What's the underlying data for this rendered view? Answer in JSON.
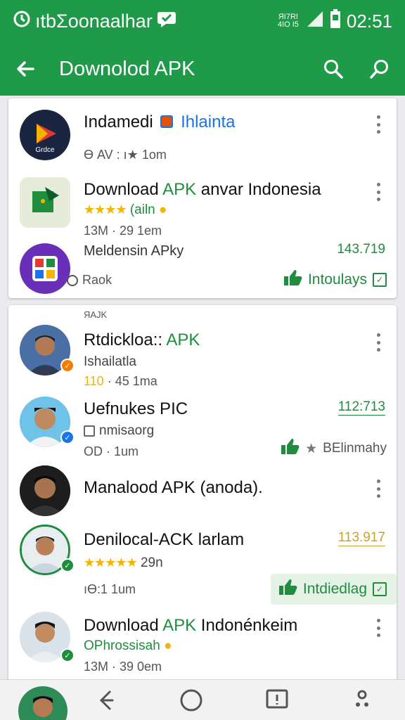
{
  "status_bar": {
    "carrier": "ıtbΣoonaalhar",
    "signal_text": "ЯI7RI\n4IO I5",
    "time": "02:51"
  },
  "app_bar": {
    "title": "Downolod APK",
    "back_icon": "arrow-left-icon",
    "search_icon": "search-icon",
    "second_search_icon": "search-icon"
  },
  "card1": {
    "items": [
      {
        "title_a": "Indamedi",
        "title_b": "Ihlainta",
        "meta": "ϴ AV : ı★ 1om"
      },
      {
        "title_a": "Download ",
        "title_b": "APK",
        "title_c": " anvar Indonesia",
        "rating_text": "(ailn",
        "meta": "13M · 29 1em"
      },
      {
        "title": "Meldensin APky",
        "price": "143.719",
        "meta": "Raok",
        "action": "Intoulays"
      }
    ]
  },
  "card2": {
    "section_label": "ЯAJK",
    "items": [
      {
        "title_a": "Rtdickloa:: ",
        "title_b": "APK",
        "subtitle": "Ishailatla",
        "meta_highlight": "110",
        "meta": " · 45 1ma"
      },
      {
        "title": "Uefnukes PIC",
        "price": "112:713",
        "subtitle": "nmisaorg",
        "meta": "OD · 1um",
        "action": "BElinmahy"
      },
      {
        "title": "Manalood APK (anoda)."
      },
      {
        "title": "Denilocal-ACK larlam",
        "price": "113.917",
        "rating_text": "29n",
        "meta": "ıϴ:1 1um",
        "action": "Intdiedlag"
      },
      {
        "title_a": "Download ",
        "title_b": "APK",
        "title_c": " Indonénkeim",
        "subtitle": "OPhrossisah",
        "meta": "13M · 39 0em"
      }
    ]
  },
  "nav_bar": {
    "back_icon": "back-icon",
    "home_icon": "home-icon",
    "recents_icon": "recents-icon",
    "assistant_icon": "assistant-icon"
  },
  "colors": {
    "brand_green": "#1f9a48",
    "accent_green": "#1e8e3e",
    "star_yellow": "#f4b400",
    "link_blue": "#1a73e8"
  }
}
